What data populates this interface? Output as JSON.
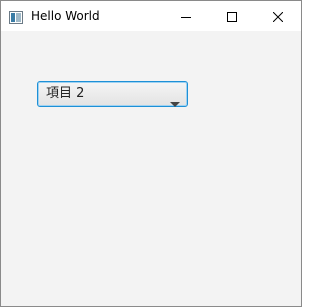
{
  "window": {
    "title": "Hello World",
    "icon": "java-app-icon",
    "controls": {
      "minimize_icon": "minimize-icon",
      "maximize_icon": "maximize-icon",
      "close_icon": "close-icon"
    }
  },
  "combo": {
    "selected_value": "項目 2",
    "arrow_icon": "chevron-down-icon",
    "focus_color": "#1e90d6"
  }
}
